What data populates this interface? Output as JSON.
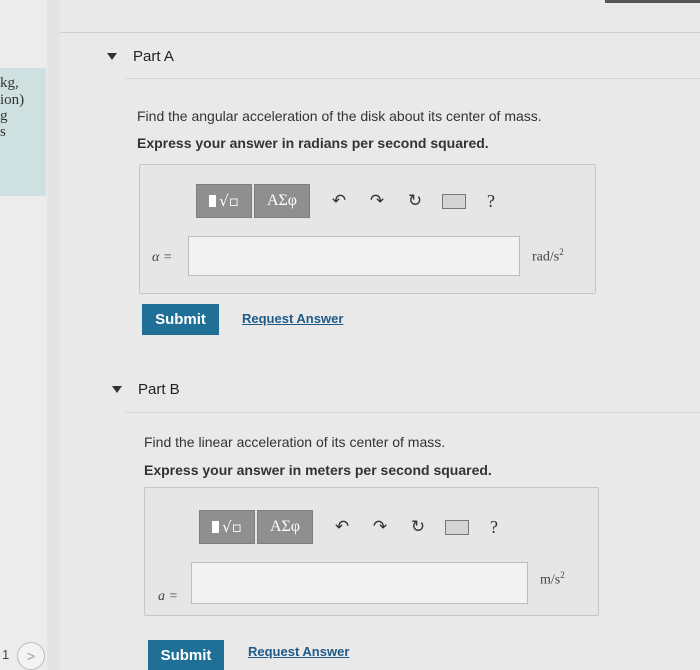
{
  "left_panel": {
    "line1": "kg,",
    "line2": "ion)",
    "line3": "g",
    "line4": "s",
    "page_number": "1",
    "nav_glyph": ">"
  },
  "part_a": {
    "header": "Part A",
    "question": "Find the angular acceleration of the disk about its center of mass.",
    "instruction": "Express your answer in radians per second squared.",
    "toolbar": {
      "greek": "ΑΣφ",
      "help": "?",
      "icons": [
        "templates-icon",
        "greek-symbols-icon",
        "undo-icon",
        "redo-icon",
        "reset-icon",
        "keyboard-icon",
        "help-icon"
      ]
    },
    "variable": "α =",
    "unit": "rad/s",
    "unit_exp": "2",
    "submit": "Submit",
    "request": "Request Answer"
  },
  "part_b": {
    "header": "Part B",
    "question": "Find the linear acceleration of its center of mass.",
    "instruction": "Express your answer in meters per second squared.",
    "toolbar": {
      "greek": "ΑΣφ",
      "help": "?"
    },
    "variable": "a =",
    "unit": "m/s",
    "unit_exp": "2",
    "submit": "Submit",
    "request": "Request Answer"
  },
  "colors": {
    "submit_bg": "#1f6f96",
    "link": "#1f5b88",
    "toolbar_btn": "#8f8f8f",
    "left_panel_bg": "#cfe0e0"
  }
}
